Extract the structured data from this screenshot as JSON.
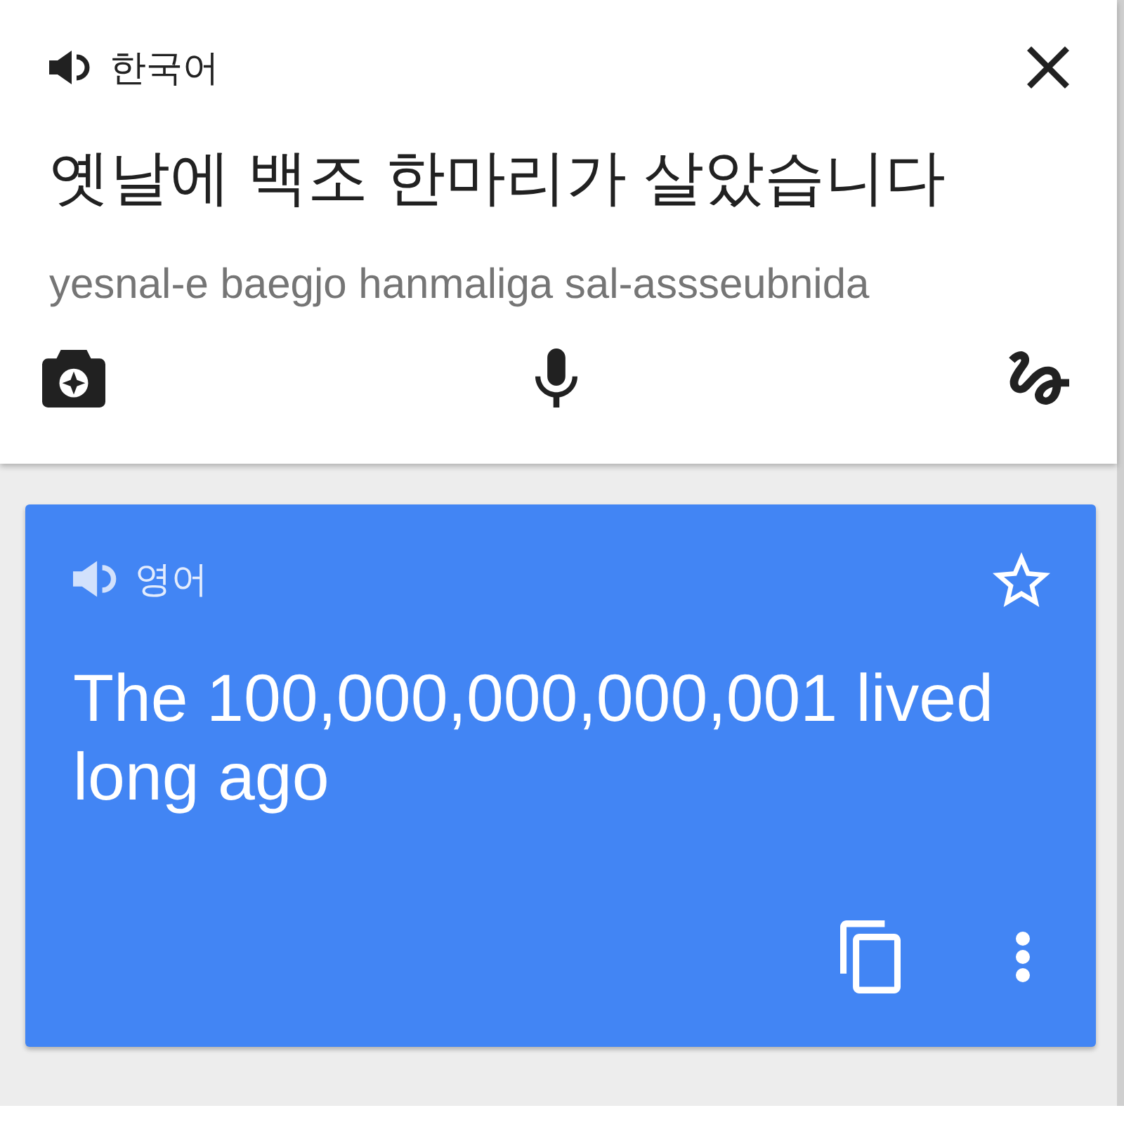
{
  "source": {
    "language": "한국어",
    "text": "옛날에 백조 한마리가 살았습니다",
    "romanization": "yesnal-e baegjo hanmaliga sal-assseubnida"
  },
  "translation": {
    "language": "영어",
    "text": "The 100,000,000,000,001 lived long ago",
    "starred": false
  }
}
